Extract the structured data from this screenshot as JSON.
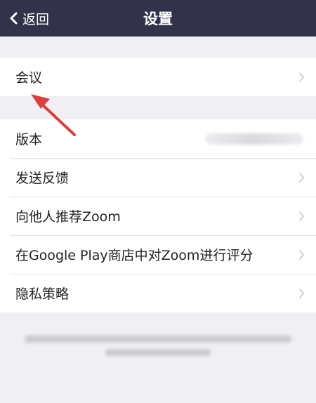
{
  "header": {
    "back_label": "返回",
    "title": "设置"
  },
  "section_meeting": {
    "items": [
      {
        "label": "会议",
        "icon": "chevron-right-icon"
      }
    ]
  },
  "section_app": {
    "items": [
      {
        "label": "版本",
        "value": ""
      },
      {
        "label": "发送反馈",
        "icon": "chevron-right-icon"
      },
      {
        "label": "向他人推荐Zoom",
        "icon": "chevron-right-icon"
      },
      {
        "label": "在Google Play商店中对Zoom进行评分",
        "icon": "chevron-right-icon"
      },
      {
        "label": "隐私策略",
        "icon": "chevron-right-icon"
      }
    ]
  },
  "colors": {
    "header_bg": "#32324a",
    "page_bg": "#f0eff4",
    "annotation_arrow": "#d9403c"
  }
}
